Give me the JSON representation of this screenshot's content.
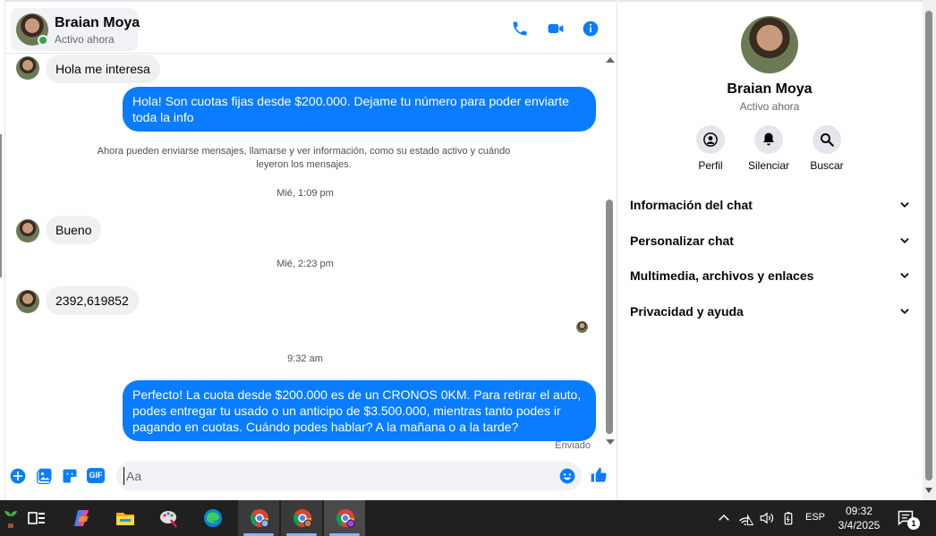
{
  "contact": {
    "name": "Braian Moya",
    "status": "Activo ahora"
  },
  "header": {
    "icons": [
      "phone-icon",
      "video-icon",
      "info-icon"
    ],
    "accent": "#0a7cff"
  },
  "messages": {
    "m1": "Hola me interesa",
    "m2": "Hola! Son cuotas fijas desde $200.000. Dejame tu número para poder enviarte toda la info",
    "system_note": "Ahora pueden enviarse mensajes, llamarse y ver información, como su estado activo y cuándo leyeron los mensajes.",
    "time1": "Mié, 1:09 pm",
    "m3": "Bueno",
    "time2": "Mié, 2:23 pm",
    "m4": "2392,619852",
    "time3": "9:32 am",
    "m5": "Perfecto! La cuota desde $200.000 es de un CRONOS 0KM. Para retirar el auto, podes entregar tu usado o un anticipo de $3.500.000, mientras tanto podes ir pagando en cuotas. Cuándo podes hablar? A la mañana o a la tarde?",
    "sent_status": "Enviado"
  },
  "composer": {
    "placeholder": "Aa",
    "gif_label": "GIF",
    "icons": [
      "add-icon",
      "photo-icon",
      "sticker-icon",
      "gif-icon",
      "emoji-icon",
      "like-icon"
    ]
  },
  "panel": {
    "name": "Braian Moya",
    "status": "Activo ahora",
    "actions": [
      {
        "label": "Perfil",
        "icon": "profile-icon"
      },
      {
        "label": "Silenciar",
        "icon": "bell-icon"
      },
      {
        "label": "Buscar",
        "icon": "search-icon"
      }
    ],
    "sections": [
      "Información del chat",
      "Personalizar chat",
      "Multimedia, archivos y enlaces",
      "Privacidad y ayuda"
    ]
  },
  "taskbar": {
    "apps": [
      "plant-icon",
      "task-view-icon",
      "copilot-icon",
      "file-explorer-icon",
      "paint-icon",
      "edge-icon",
      "chrome-profile-1-icon",
      "chrome-icon",
      "chrome-profile-2-icon"
    ],
    "language": "ESP",
    "time": "09:32",
    "date": "3/4/2025",
    "notification_count": "1"
  }
}
